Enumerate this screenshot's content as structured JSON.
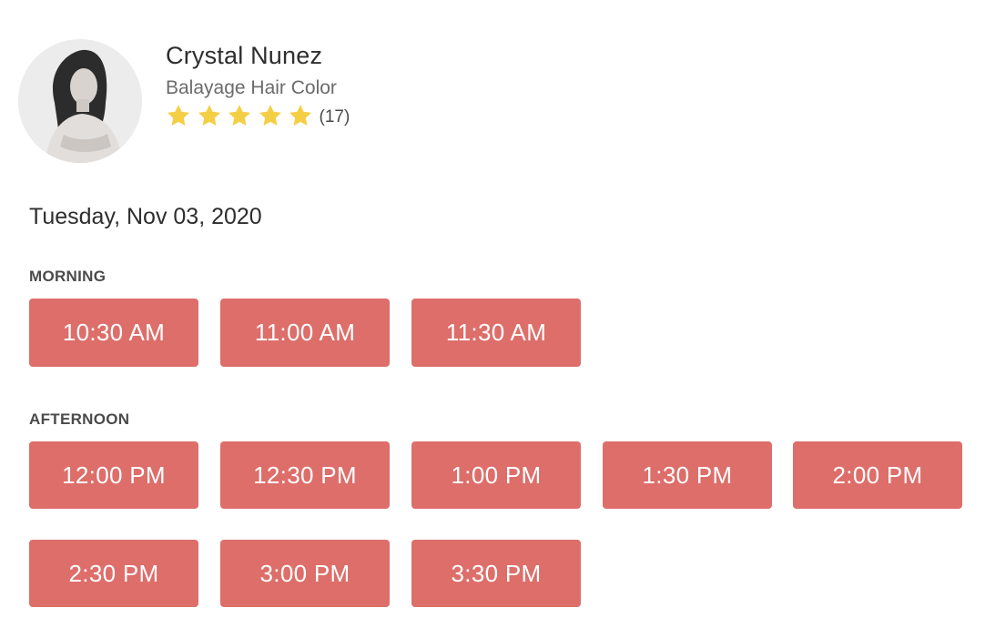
{
  "stylist": {
    "name": "Crystal Nunez",
    "service": "Balayage Hair Color",
    "rating_stars": 5,
    "review_count": "(17)",
    "star_color": "#f4cf45"
  },
  "date": "Tuesday, Nov 03, 2020",
  "slot_color": "#dd6e6a",
  "morning": {
    "label": "MORNING",
    "slots": [
      "10:30 AM",
      "11:00 AM",
      "11:30 AM"
    ]
  },
  "afternoon": {
    "label": "AFTERNOON",
    "slots": [
      "12:00 PM",
      "12:30 PM",
      "1:00 PM",
      "1:30 PM",
      "2:00 PM",
      "2:30 PM",
      "3:00 PM",
      "3:30 PM"
    ]
  }
}
